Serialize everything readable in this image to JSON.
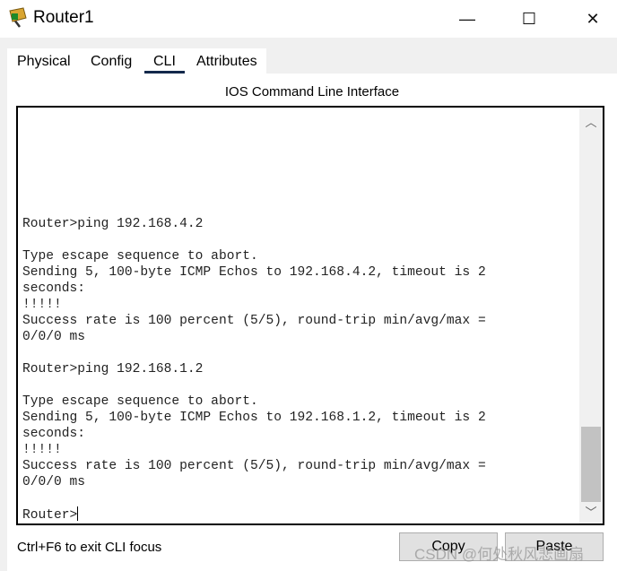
{
  "window": {
    "title": "Router1",
    "minimize": "—",
    "maximize": "☐",
    "close": "✕"
  },
  "tabs": [
    {
      "label": "Physical",
      "active": false
    },
    {
      "label": "Config",
      "active": false
    },
    {
      "label": "CLI",
      "active": true
    },
    {
      "label": "Attributes",
      "active": false
    }
  ],
  "panel_header": "IOS Command Line Interface",
  "terminal": {
    "lines": [
      "Router>ping 192.168.4.2",
      "",
      "Type escape sequence to abort.",
      "Sending 5, 100-byte ICMP Echos to 192.168.4.2, timeout is 2",
      "seconds:",
      "!!!!!",
      "Success rate is 100 percent (5/5), round-trip min/avg/max =",
      "0/0/0 ms",
      "",
      "Router>ping 192.168.1.2",
      "",
      "Type escape sequence to abort.",
      "Sending 5, 100-byte ICMP Echos to 192.168.1.2, timeout is 2",
      "seconds:",
      "!!!!!",
      "Success rate is 100 percent (5/5), round-trip min/avg/max =",
      "0/0/0 ms",
      ""
    ],
    "prompt": "Router>"
  },
  "footer": {
    "hint": "Ctrl+F6 to exit CLI focus",
    "copy_label": "Copy",
    "paste_label": "Paste"
  },
  "watermark": "CSDN @何处秋风悲画扇",
  "colors": {
    "active_tab_underline": "#13294b"
  }
}
